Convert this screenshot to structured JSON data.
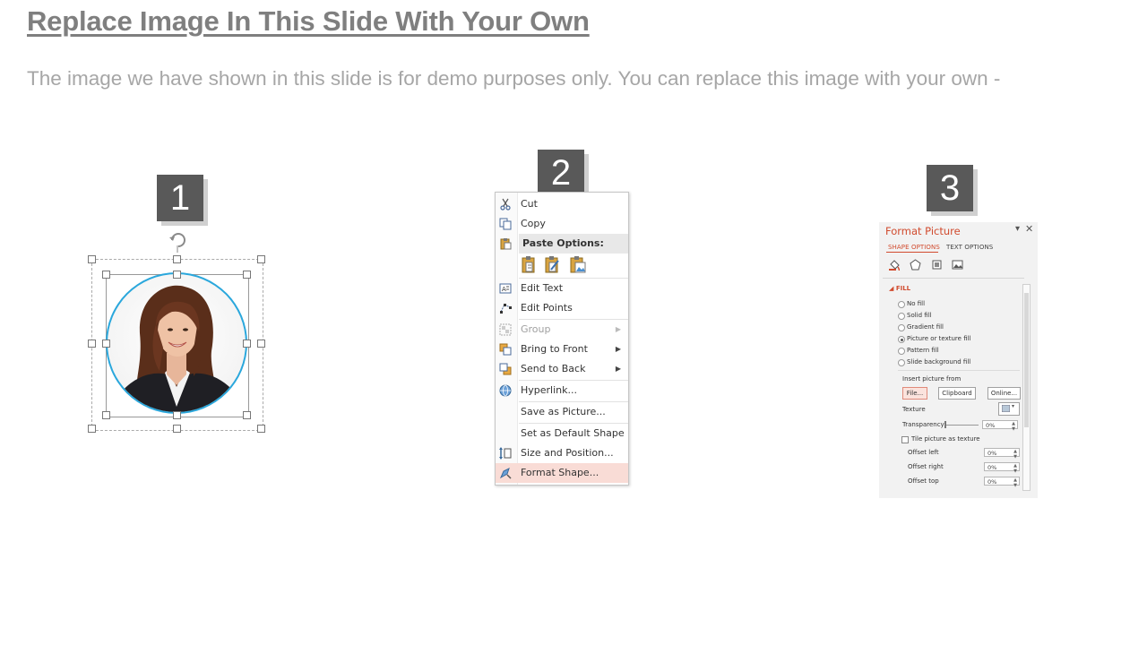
{
  "slide": {
    "title": "Replace Image In This Slide With Your Own",
    "subtitle": "The image we have shown in this slide is for demo purposes only. You can replace this image with your own -"
  },
  "steps": [
    {
      "number": "1"
    },
    {
      "number": "2"
    },
    {
      "number": "3"
    }
  ],
  "context_menu": {
    "items": [
      {
        "label": "Cut",
        "icon": "scissors-icon"
      },
      {
        "label": "Copy",
        "icon": "copy-icon"
      },
      {
        "label": "Paste Options:",
        "icon": "paste-icon"
      },
      {
        "label": "Edit Text",
        "icon": "edit-text-icon"
      },
      {
        "label": "Edit Points",
        "icon": "edit-points-icon"
      },
      {
        "label": "Group",
        "icon": "group-icon"
      },
      {
        "label": "Bring to Front",
        "icon": "bring-to-front-icon"
      },
      {
        "label": "Send to Back",
        "icon": "send-to-back-icon"
      },
      {
        "label": "Hyperlink...",
        "icon": "hyperlink-icon"
      },
      {
        "label": "Save as Picture..."
      },
      {
        "label": "Set as Default Shape"
      },
      {
        "label": "Size and Position...",
        "icon": "size-position-icon"
      },
      {
        "label": "Format Shape...",
        "icon": "format-shape-icon"
      }
    ]
  },
  "format_pane": {
    "title": "Format Picture",
    "tabs": [
      "SHAPE OPTIONS",
      "TEXT OPTIONS"
    ],
    "section": "FILL",
    "fill_options": [
      "No fill",
      "Solid fill",
      "Gradient fill",
      "Picture or texture fill",
      "Pattern fill",
      "Slide background fill"
    ],
    "selected_fill": "Picture or texture fill",
    "insert_from_label": "Insert picture from",
    "buttons": [
      "File...",
      "Clipboard",
      "Online..."
    ],
    "texture_label": "Texture",
    "transparency_label": "Transparency",
    "transparency_value": "0%",
    "tile_label": "Tile picture as texture",
    "offsets": [
      {
        "label": "Offset left",
        "value": "0%"
      },
      {
        "label": "Offset right",
        "value": "0%"
      },
      {
        "label": "Offset top",
        "value": "0%"
      }
    ]
  },
  "colors": {
    "accent": "#d14b2e",
    "badge": "#595959",
    "title": "#7f7f7f",
    "photo_ring": "#2aa7dc"
  }
}
